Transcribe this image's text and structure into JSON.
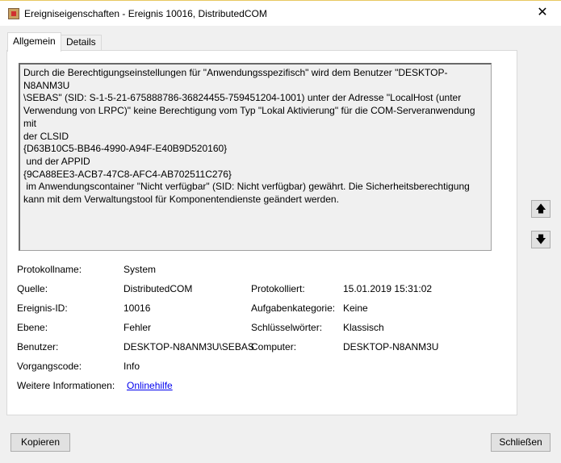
{
  "window": {
    "title": "Ereigniseigenschaften - Ereignis 10016, DistributedCOM",
    "close": "✕"
  },
  "tabs": [
    "Allgemein",
    "Details"
  ],
  "description": "Durch die Berechtigungseinstellungen für \"Anwendungsspezifisch\" wird dem Benutzer \"DESKTOP-N8ANM3U\n\\SEBAS\" (SID: S-1-5-21-675888786-36824455-759451204-1001) unter der Adresse \"LocalHost (unter\nVerwendung von LRPC)\" keine Berechtigung vom Typ \"Lokal Aktivierung\" für die COM-Serveranwendung mit\nder CLSID\n{D63B10C5-BB46-4990-A94F-E40B9D520160}\n und der APPID\n{9CA88EE3-ACB7-47C8-AFC4-AB702511C276}\n im Anwendungscontainer \"Nicht verfügbar\" (SID: Nicht verfügbar) gewährt. Die Sicherheitsberechtigung\nkann mit dem Verwaltungstool für Komponentendienste geändert werden.",
  "arrows": {
    "up": "🡅",
    "down": "🡇"
  },
  "fields": {
    "protokollname": {
      "label": "Protokollname:",
      "value": "System"
    },
    "quelle": {
      "label": "Quelle:",
      "value": "DistributedCOM"
    },
    "protokolliert": {
      "label": "Protokolliert:",
      "value": "15.01.2019 15:31:02"
    },
    "ereignis_id": {
      "label": "Ereignis-ID:",
      "value": "10016"
    },
    "aufgabenkategorie": {
      "label": "Aufgabenkategorie:",
      "value": "Keine"
    },
    "ebene": {
      "label": "Ebene:",
      "value": "Fehler"
    },
    "schluesselwoerter": {
      "label": "Schlüsselwörter:",
      "value": "Klassisch"
    },
    "benutzer": {
      "label": "Benutzer:",
      "value": "DESKTOP-N8ANM3U\\SEBAS"
    },
    "computer": {
      "label": "Computer:",
      "value": "DESKTOP-N8ANM3U"
    },
    "vorgangscode": {
      "label": "Vorgangscode:",
      "value": "Info"
    },
    "weitere": {
      "label": "Weitere Informationen:",
      "value": "Onlinehilfe"
    }
  },
  "buttons": {
    "copy": "Kopieren",
    "close": "Schließen"
  }
}
